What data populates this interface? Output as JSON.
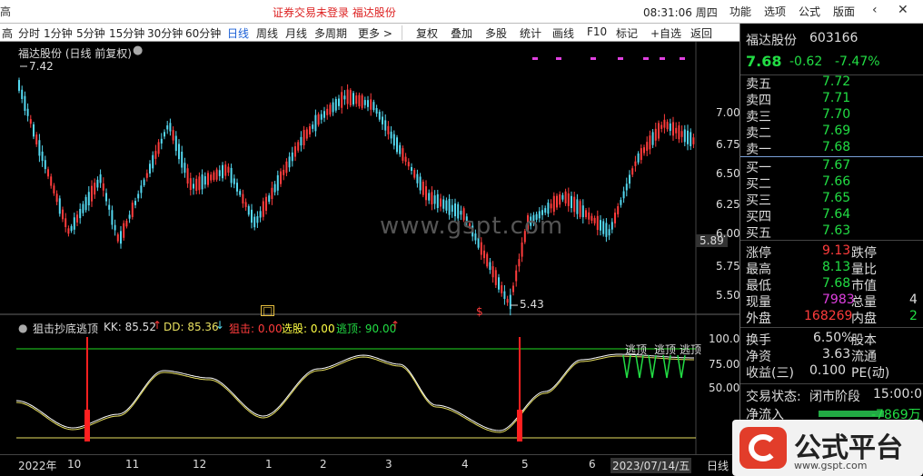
{
  "titlebar": {
    "left_glyph": "高",
    "title": "证券交易未登录   福达股份",
    "clock": "08:31:06 周四",
    "menus": [
      "功能",
      "选项",
      "公式",
      "版面"
    ],
    "minimize_icon": "chevron-left-icon",
    "close_icon": "close-icon"
  },
  "toolbar": {
    "periods": [
      "分时",
      "1分钟",
      "5分钟",
      "15分钟",
      "30分钟",
      "60分钟",
      "日线",
      "周线",
      "月线",
      "多周期",
      "更多 >"
    ],
    "active_period": "日线",
    "tools": [
      "复权",
      "叠加",
      "多股",
      "统计",
      "画线",
      "F10",
      "标记",
      "+自选",
      "返回"
    ]
  },
  "chart": {
    "header": "福达股份 (日线 前复权)",
    "high_label": "7.42",
    "low_label": "5.43",
    "last_price_tag": "5.89",
    "y_ticks": [
      "7.00",
      "6.75",
      "6.50",
      "6.25",
      "6.00",
      "5.75",
      "5.50"
    ],
    "watermark": "www.gspt.com",
    "up_color": "#ff3c3c",
    "down_color": "#54d8f0",
    "signal_marker": "$"
  },
  "indicator": {
    "name": "狙击抄底逃顶",
    "kk": "KK: 85.52",
    "dd": "DD: 85.36",
    "jj": "狙击: 0.00",
    "xg": "选股: 0.00",
    "td": "逃顶: 90.00",
    "y_ticks": [
      "100.0",
      "75.00",
      "50.00"
    ],
    "escape_labels": [
      "逃顶",
      "逃顶",
      "逃顶"
    ],
    "upper_line_color": "#22dd22",
    "lower_line_color": "#e8e060"
  },
  "date_axis": {
    "labels": [
      "2022年",
      "10",
      "11",
      "12",
      "1",
      "2",
      "3",
      "4",
      "5",
      "6"
    ],
    "cursor_date": "2023/07/14/五",
    "period_button": "日线"
  },
  "quote": {
    "name": "福达股份",
    "code": "603166",
    "price": "7.68",
    "change": "-0.62",
    "pct": "-7.47%",
    "sell": [
      {
        "label": "卖五",
        "price": "7.72"
      },
      {
        "label": "卖四",
        "price": "7.71"
      },
      {
        "label": "卖三",
        "price": "7.70"
      },
      {
        "label": "卖二",
        "price": "7.69"
      },
      {
        "label": "卖一",
        "price": "7.68"
      }
    ],
    "buy": [
      {
        "label": "买一",
        "price": "7.67"
      },
      {
        "label": "买二",
        "price": "7.66"
      },
      {
        "label": "买三",
        "price": "7.65"
      },
      {
        "label": "买四",
        "price": "7.64"
      },
      {
        "label": "买五",
        "price": "7.63"
      }
    ],
    "stats": [
      {
        "label": "涨停",
        "value": "9.13",
        "label2": "跌停"
      },
      {
        "label": "最高",
        "value": "8.13",
        "label2": "量比"
      },
      {
        "label": "最低",
        "value": "7.68",
        "label2": "市值"
      },
      {
        "label": "现量",
        "value": "7983",
        "label2": "总量",
        "extra": "4"
      },
      {
        "label": "外盘",
        "value": "168269",
        "label2": "内盘",
        "extra": "2"
      }
    ],
    "finance": [
      {
        "label": "换手",
        "value": "6.50%",
        "label2": "股本"
      },
      {
        "label": "净资",
        "value": "3.63",
        "label2": "流通"
      },
      {
        "label": "收益(三)",
        "value": "0.100",
        "label2": "PE(动)"
      }
    ],
    "status_label": "交易状态:",
    "status_value": "闭市阶段",
    "status_time": "15:00:0",
    "inflow_label": "净流入",
    "inflow_value": "-7869万"
  },
  "logo": {
    "text": "公式平台",
    "url": "www.gspt.com"
  }
}
